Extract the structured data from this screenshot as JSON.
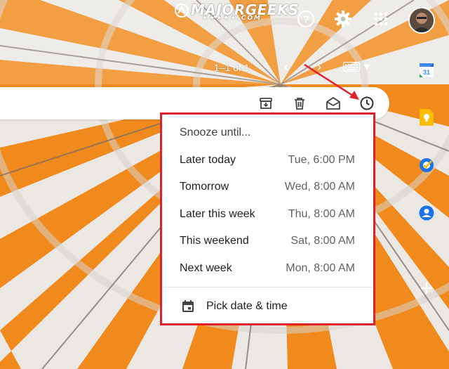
{
  "watermark": {
    "main": "MAJORGEEKS",
    "sub": "★★★★★.COM"
  },
  "header": {
    "icons": [
      "help-icon",
      "settings-gear-icon",
      "apps-grid-icon"
    ],
    "avatar_alt": "account-avatar"
  },
  "pagination": {
    "range_text": "1–1 of 1"
  },
  "toolbar": {
    "icons": [
      "archive-icon",
      "delete-icon",
      "mark-unread-icon",
      "snooze-clock-icon"
    ]
  },
  "side_panel": {
    "icons": [
      "calendar-icon",
      "keep-icon",
      "tasks-icon",
      "contacts-icon",
      "add-icon"
    ],
    "calendar_day": "31"
  },
  "snooze_menu": {
    "title": "Snooze until...",
    "options": [
      {
        "label": "Later today",
        "value": "Tue, 6:00 PM"
      },
      {
        "label": "Tomorrow",
        "value": "Wed, 8:00 AM"
      },
      {
        "label": "Later this week",
        "value": "Thu, 8:00 AM"
      },
      {
        "label": "This weekend",
        "value": "Sat, 8:00 AM"
      },
      {
        "label": "Next week",
        "value": "Mon, 8:00 AM"
      }
    ],
    "pick_label": "Pick date & time"
  },
  "colors": {
    "accent_red": "#e0202a",
    "umbrella_orange": "#f08a1c",
    "umbrella_white": "#e8e6e3"
  }
}
